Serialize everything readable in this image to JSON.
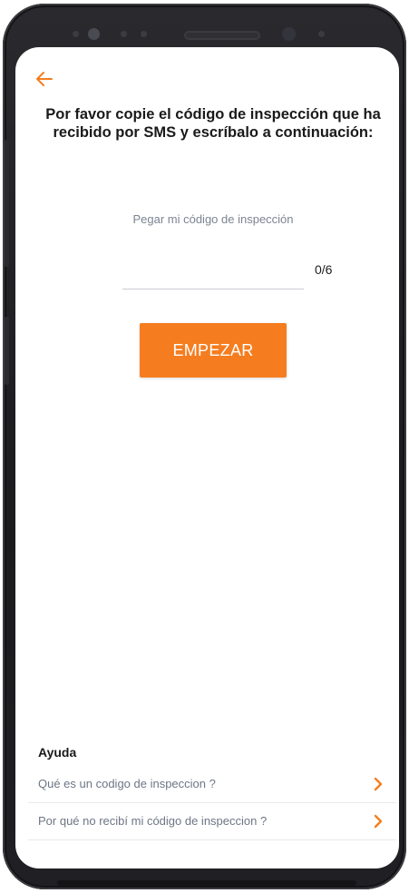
{
  "header": {
    "back_icon": "arrow-left-icon"
  },
  "main": {
    "title": "Por favor copie el código de inspección que ha recibido por SMS y escríbalo a continuación:",
    "hint": "Pegar mi código de inspección",
    "code_value": "",
    "counter": "0/6",
    "start_label": "EMPEZAR"
  },
  "help": {
    "title": "Ayuda",
    "items": [
      {
        "label": "Qué es un codigo de inspeccion ?",
        "icon": "chevron-right-icon"
      },
      {
        "label": "Por qué no recibí mi código de inspeccion ?",
        "icon": "chevron-right-icon"
      }
    ]
  },
  "colors": {
    "accent": "#F57D1F",
    "text": "#1A1A1A",
    "muted": "#7B8493"
  }
}
